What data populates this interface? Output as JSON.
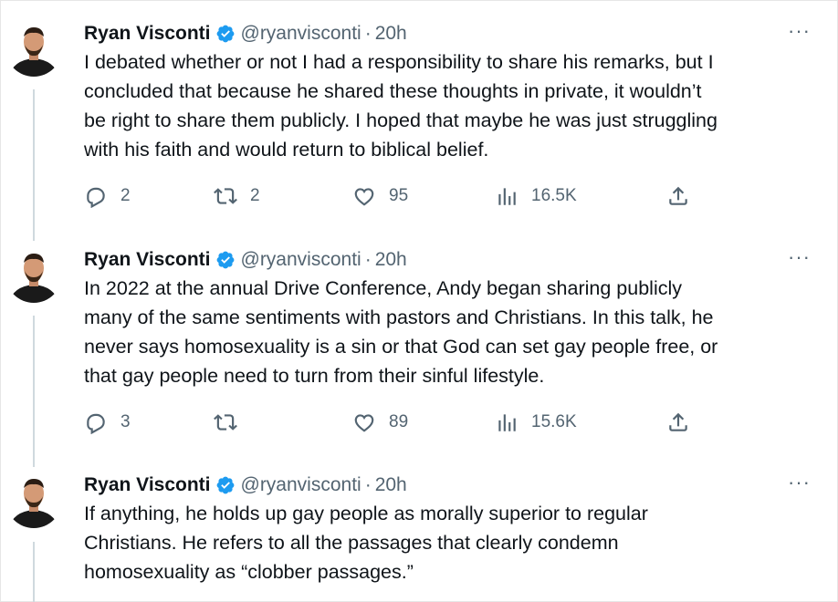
{
  "tweets": [
    {
      "author": "Ryan Visconti",
      "handle": "@ryanvisconti",
      "separator": "·",
      "time": "20h",
      "more_icon": "more-icon",
      "text": "I debated whether or not I had a responsibility to share his remarks, but I\nconcluded that because he shared these thoughts in private, it wouldn’t\nbe right to share them publicly. I hoped that maybe he was just struggling\nwith his faith and would return to biblical belief.",
      "replies": "2",
      "reposts": "2",
      "likes": "95",
      "views": "16.5K"
    },
    {
      "author": "Ryan Visconti",
      "handle": "@ryanvisconti",
      "separator": "·",
      "time": "20h",
      "more_icon": "more-icon",
      "text": "In 2022 at the annual Drive Conference, Andy began sharing publicly\nmany of the same sentiments with pastors and Christians. In this talk, he\nnever says homosexuality is a sin or that God can set gay people free, or\nthat gay people need to turn from their sinful lifestyle.",
      "replies": "3",
      "reposts": "",
      "likes": "89",
      "views": "15.6K"
    },
    {
      "author": "Ryan Visconti",
      "handle": "@ryanvisconti",
      "separator": "·",
      "time": "20h",
      "more_icon": "more-icon",
      "text": "If anything, he holds up gay people as morally superior to regular\nChristians. He refers to all the passages that clearly condemn\nhomosexuality as “clobber passages.”"
    }
  ],
  "colors": {
    "text": "#0f1419",
    "muted": "#536471",
    "verified": "#1d9bf0",
    "thread_line": "#cfd9de"
  }
}
